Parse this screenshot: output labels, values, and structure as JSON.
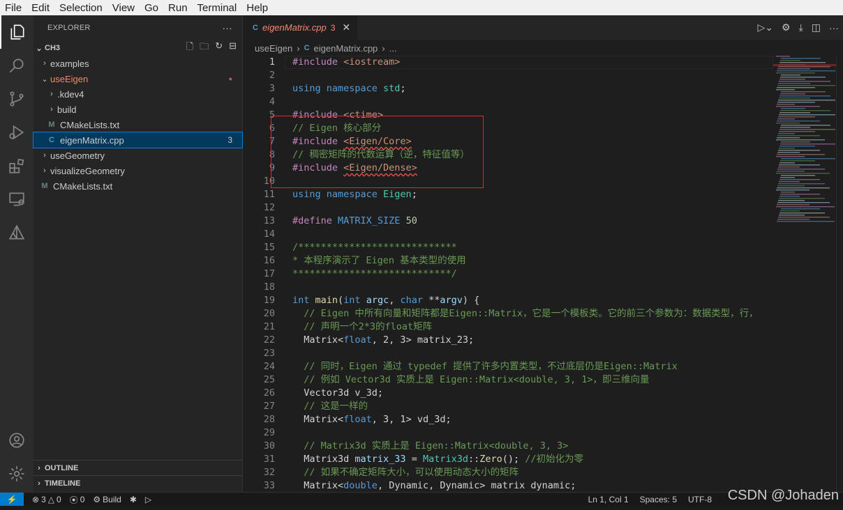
{
  "menu": [
    "File",
    "Edit",
    "Selection",
    "View",
    "Go",
    "Run",
    "Terminal",
    "Help"
  ],
  "explorer": {
    "title": "EXPLORER",
    "root": "CH3",
    "items": [
      {
        "label": "examples",
        "kind": "folder",
        "depth": 1,
        "open": false
      },
      {
        "label": "useEigen",
        "kind": "folder",
        "depth": 1,
        "open": true,
        "modified": true
      },
      {
        "label": ".kdev4",
        "kind": "folder",
        "depth": 2,
        "open": false
      },
      {
        "label": "build",
        "kind": "folder",
        "depth": 2,
        "open": false
      },
      {
        "label": "CMakeLists.txt",
        "kind": "cmake",
        "depth": 2
      },
      {
        "label": "eigenMatrix.cpp",
        "kind": "cpp",
        "depth": 2,
        "selected": true,
        "badge": "3"
      },
      {
        "label": "useGeometry",
        "kind": "folder",
        "depth": 1,
        "open": false
      },
      {
        "label": "visualizeGeometry",
        "kind": "folder",
        "depth": 1,
        "open": false
      },
      {
        "label": "CMakeLists.txt",
        "kind": "cmake",
        "depth": 1
      }
    ],
    "outline": "OUTLINE",
    "timeline": "TIMELINE"
  },
  "tab": {
    "label": "eigenMatrix.cpp",
    "problems": "3"
  },
  "breadcrumb": {
    "folder": "useEigen",
    "file": "eigenMatrix.cpp",
    "tail": "..."
  },
  "code": [
    [
      [
        "pp",
        "#include "
      ],
      [
        "str",
        "<iostream>"
      ]
    ],
    [],
    [
      [
        "kw",
        "using namespace "
      ],
      [
        "ns",
        "std"
      ],
      [
        "tx",
        ";"
      ]
    ],
    [],
    [
      [
        "pp",
        "#include "
      ],
      [
        "str",
        "<ctime>"
      ]
    ],
    [
      [
        "cm",
        "// Eigen 核心部分"
      ]
    ],
    [
      [
        "pp",
        "#include "
      ],
      [
        "strsq",
        "<Eigen/Core>"
      ]
    ],
    [
      [
        "cm",
        "// 稠密矩阵的代数运算（逆，特征值等）"
      ]
    ],
    [
      [
        "pp",
        "#include "
      ],
      [
        "strsq",
        "<Eigen/Dense>"
      ]
    ],
    [],
    [
      [
        "kw",
        "using namespace "
      ],
      [
        "ns",
        "Eigen"
      ],
      [
        "tx",
        ";"
      ]
    ],
    [],
    [
      [
        "pp",
        "#define "
      ],
      [
        "mac",
        "MATRIX_SIZE "
      ],
      [
        "num",
        "50"
      ]
    ],
    [],
    [
      [
        "cm",
        "/****************************"
      ]
    ],
    [
      [
        "cm",
        "* 本程序演示了 Eigen 基本类型的使用"
      ]
    ],
    [
      [
        "cm",
        "****************************/"
      ]
    ],
    [],
    [
      [
        "kw",
        "int "
      ],
      [
        "fn",
        "main"
      ],
      [
        "tx",
        "("
      ],
      [
        "kw",
        "int "
      ],
      [
        "var",
        "argc"
      ],
      [
        "tx",
        ", "
      ],
      [
        "kw",
        "char "
      ],
      [
        "tx",
        "**"
      ],
      [
        "var",
        "argv"
      ],
      [
        "tx",
        ") {"
      ]
    ],
    [
      [
        "cm",
        "  // Eigen 中所有向量和矩阵都是Eigen::Matrix，它是一个模板类。它的前三个参数为：数据类型，行，"
      ]
    ],
    [
      [
        "cm",
        "  // 声明一个2*3的float矩阵"
      ]
    ],
    [
      [
        "tx",
        "  Matrix<"
      ],
      [
        "kw",
        "float"
      ],
      [
        "tx",
        ", 2, 3> matrix_23;"
      ]
    ],
    [],
    [
      [
        "cm",
        "  // 同时，Eigen 通过 typedef 提供了许多内置类型，不过底层仍是Eigen::Matrix"
      ]
    ],
    [
      [
        "cm",
        "  // 例如 Vector3d 实质上是 Eigen::Matrix<double, 3, 1>，即三维向量"
      ]
    ],
    [
      [
        "tx",
        "  Vector3d v_3d;"
      ]
    ],
    [
      [
        "cm",
        "  // 这是一样的"
      ]
    ],
    [
      [
        "tx",
        "  Matrix<"
      ],
      [
        "kw",
        "float"
      ],
      [
        "tx",
        ", 3, 1> vd_3d;"
      ]
    ],
    [],
    [
      [
        "cm",
        "  // Matrix3d 实质上是 Eigen::Matrix<double, 3, 3>"
      ]
    ],
    [
      [
        "tx",
        "  Matrix3d "
      ],
      [
        "var",
        "matrix_33"
      ],
      [
        "tx",
        " = "
      ],
      [
        "ns",
        "Matrix3d"
      ],
      [
        "tx",
        "::"
      ],
      [
        "fn",
        "Zero"
      ],
      [
        "tx",
        "(); "
      ],
      [
        "cm",
        "//初始化为零"
      ]
    ],
    [
      [
        "cm",
        "  // 如果不确定矩阵大小，可以使用动态大小的矩阵"
      ]
    ],
    [
      [
        "tx",
        "  Matrix<"
      ],
      [
        "kw",
        "double"
      ],
      [
        "tx",
        ", Dynamic, Dynamic> matrix dynamic;"
      ]
    ]
  ],
  "status": {
    "errors": "3",
    "warnings": "0",
    "ports": "0",
    "build": "Build",
    "position": "Ln 1, Col 1",
    "spaces": "Spaces: 5",
    "encoding": "UTF-8"
  },
  "watermark": "CSDN @Johaden"
}
